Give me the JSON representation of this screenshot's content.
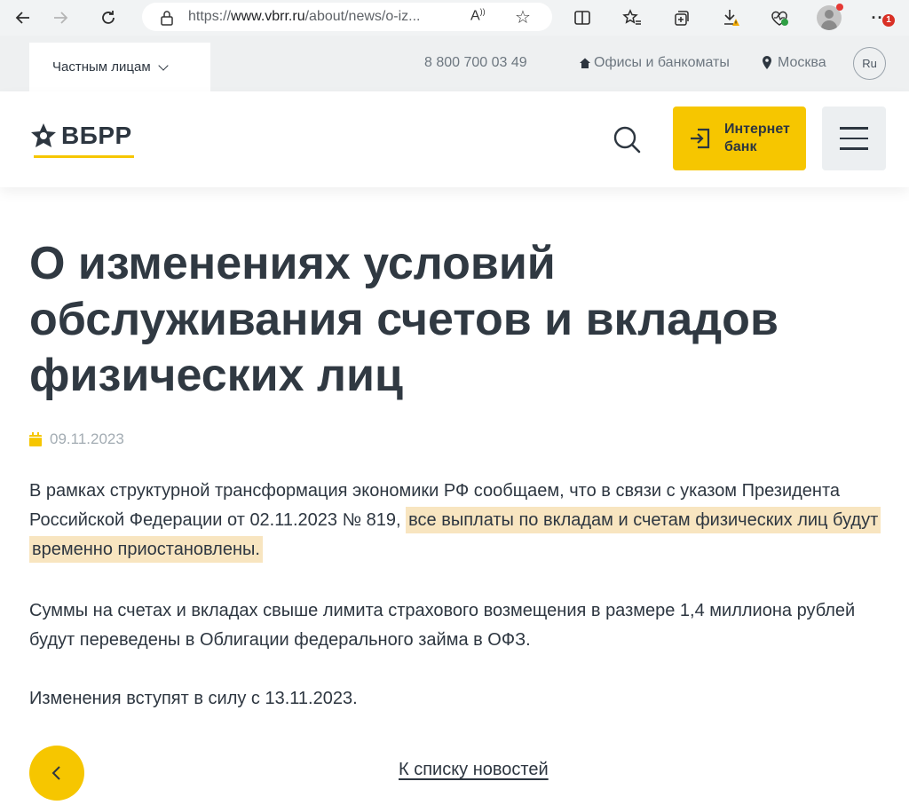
{
  "browser": {
    "url_prefix": "https://",
    "url_host": "www.vbrr.ru",
    "url_path": "/about/news/o-iz...",
    "read_aloud_label": "A",
    "badge_count": "1"
  },
  "topbar": {
    "persona_label": "Частным лицам",
    "phone": "8 800 700 03 49",
    "offices_label": "Офисы и банкоматы",
    "city": "Москва",
    "lang": "Ru"
  },
  "header": {
    "logo_text": "ВБРР",
    "ibank_label": "Интернет банк",
    "brand_yellow": "#f6c600"
  },
  "article": {
    "title": "О изменениях условий обслуживания счетов и вкладов физических лиц",
    "date": "09.11.2023",
    "p1_plain": "В рамках структурной трансформация экономики РФ сообщаем, что в связи с указом Президента Российской Федерации от 02.11.2023 № 819,",
    "p1_highlight": "все выплаты по вкладам и счетам физических лиц будут временно приостановлены.",
    "p2": "Суммы на счетах и вкладах свыше лимита страхового возмещения в размере 1,4 миллиона рублей будут переведены в Облигации федерального займа в ОФЗ.",
    "p3": "Изменения вступят в силу с 13.11.2023.",
    "highlight_color": "#f8e5c0"
  },
  "footer_nav": {
    "back_link": "К списку новостей"
  }
}
